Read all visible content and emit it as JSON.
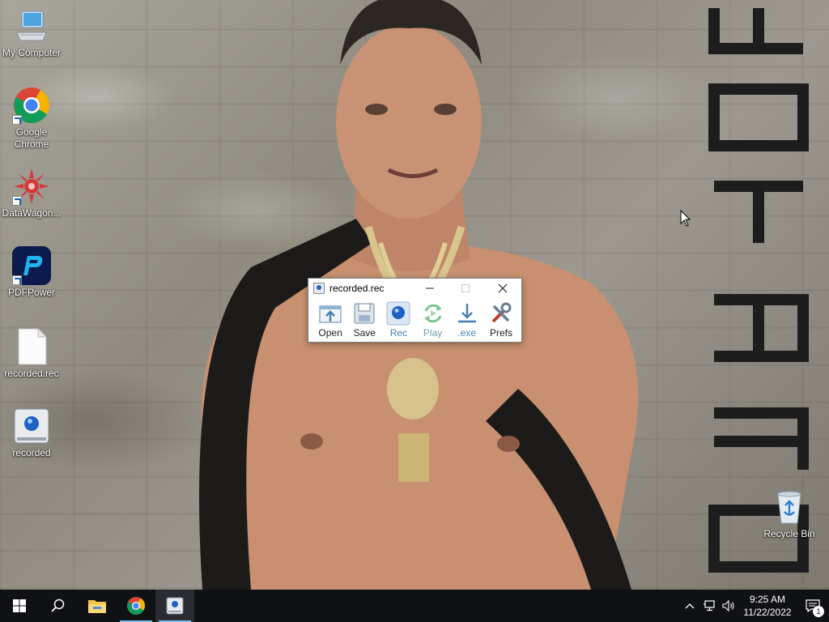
{
  "desktop": {
    "icons": [
      {
        "label": "My Computer",
        "icon": "computer-icon"
      },
      {
        "label": "Google Chrome",
        "icon": "chrome-icon"
      },
      {
        "label": "DataWagon...",
        "icon": "datawagon-icon"
      },
      {
        "label": "PDFPower",
        "icon": "pdfpower-icon"
      },
      {
        "label": "recorded.rec",
        "icon": "file-icon"
      },
      {
        "label": "recorded",
        "icon": "recorder-app-icon"
      },
      {
        "label": "Recycle Bin",
        "icon": "recycle-bin-icon"
      }
    ]
  },
  "window": {
    "title": "recorded.rec",
    "tools": [
      {
        "label": "Open",
        "icon": "open-icon"
      },
      {
        "label": "Save",
        "icon": "save-icon"
      },
      {
        "label": "Rec",
        "icon": "record-icon"
      },
      {
        "label": "Play",
        "icon": "play-icon"
      },
      {
        "label": ".exe",
        "icon": "download-exe-icon"
      },
      {
        "label": "Prefs",
        "icon": "prefs-icon"
      }
    ]
  },
  "taskbar": {
    "time": "9:25 AM",
    "date": "11/22/2022",
    "notification_count": "1"
  },
  "colors": {
    "taskbar_bg": "#101114",
    "accent": "#76b9ed"
  }
}
